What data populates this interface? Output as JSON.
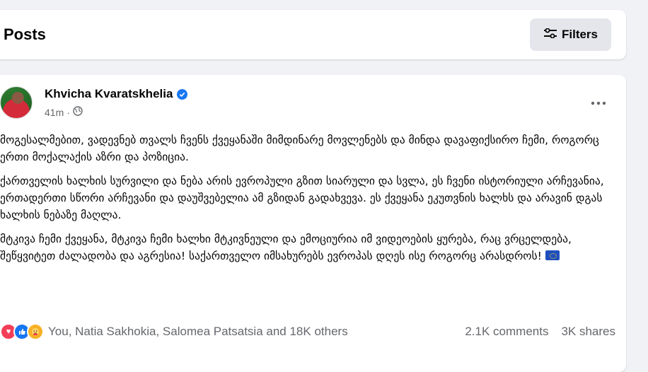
{
  "header": {
    "title": "Posts",
    "filters_label": "Filters"
  },
  "post": {
    "author": "Khvicha Kvaratskhelia",
    "time": "41m",
    "meta_separator": "·",
    "paragraphs": [
      "მოგესალმებით, ვადევნებ თვალს ჩვენს ქვეყანაში მიმდინარე მოვლენებს და მინდა დავაფიქსირო ჩემი, როგორც ერთი მოქალაქის აზრი და პოზიცია.",
      "ქართველის ხალხის სურვილი და ნება არის ევროპული გზით სიარული და სვლა, ეს ჩვენი ისტორიული არჩევანია, ერთადერთი სწორი არჩევანი და დაუშვებელია ამ გზიდან გადახვევა. ეს ქვეყანა ეკუთვნის ხალხს და არავინ დგას ხალხის ნებაზე მაღლა.",
      "მტკივა ჩემი ქვეყანა, მტკივა ჩემი ხალხი მტკივნეული და ემოციურია იმ ვიდეოების ყურება, რაც ვრცელდება, შეწყვიტეთ ძალადობა და აგრესია! საქართველო იმსახურებს ევროპას დღეს ისე როგორც არასდროს!"
    ],
    "reactions_text": "You, Natia Sakhokia, Salomea Patsatsia and 18K others",
    "comments": "2.1K comments",
    "shares": "3K shares"
  },
  "icons": [
    "filter-icon",
    "verified-icon",
    "globe-icon",
    "more-icon",
    "eu-flag-icon",
    "love-icon",
    "like-icon",
    "care-icon"
  ],
  "colors": {
    "accent": "#1877f2",
    "background": "#f0f2f5",
    "secondary_text": "#65676b",
    "button_bg": "#e4e6eb"
  }
}
